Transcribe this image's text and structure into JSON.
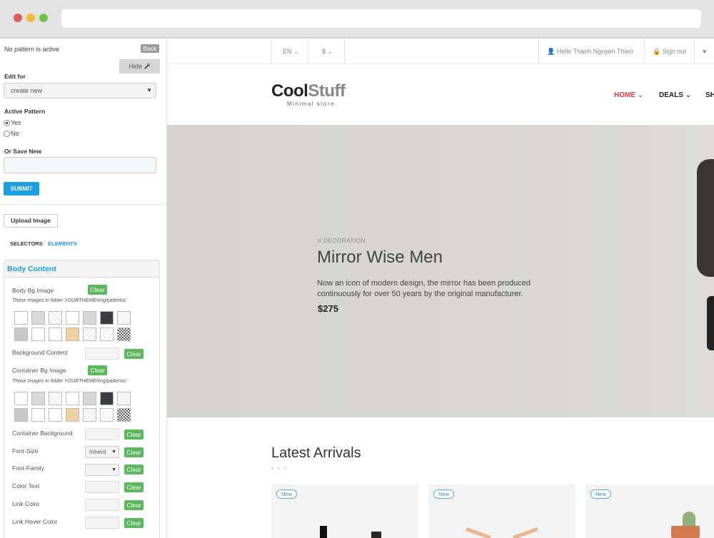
{
  "panel": {
    "status": "No pattern is active",
    "back": "Back",
    "hide": "Hide",
    "edit_for_label": "Edit for",
    "edit_for_value": "create new",
    "active_pattern_label": "Active Pattern",
    "yes": "Yes",
    "no": "No",
    "save_new_label": "Or Save New",
    "submit": "SUBMIT",
    "upload": "Upload Image",
    "tab_selectors": "SELECTORS",
    "tab_elements": "ELEMENTS"
  },
  "body_content": {
    "title": "Body Content",
    "clear": "Clear",
    "body_bg_image": "Body Bg Image",
    "folder_note": "Those Images in folder YOURTHEME/img/patterns/",
    "background_content": "Background Content",
    "container_bg_image": "Container Bg Image",
    "container_background": "Container Background",
    "font_size": "Font-Size",
    "font_size_value": "Inherit",
    "font_family": "Font-Family",
    "color_text": "Color Text",
    "link_color": "Link Color",
    "link_hover_color": "Link Hover Color"
  },
  "topbar": {
    "lang": "EN",
    "currency": "$",
    "greeting": "Hello Thanh Nguyen Thien",
    "signout": "Sign out"
  },
  "logo": {
    "part1": "Cool",
    "part2": "Stuff",
    "tagline": "Minimal store"
  },
  "nav": {
    "home": "HOME",
    "deals": "DEALS",
    "partial": "SH"
  },
  "hero": {
    "category": "// DECORATION",
    "title": "Mirror Wise Men",
    "description": "Now an icon of modern design, the mirror has been produced continuously for over 50 years by the original manufacturer.",
    "price": "$275"
  },
  "latest": {
    "title": "Latest Arrivals",
    "dots": "• • •",
    "badge": "New"
  },
  "colors": {
    "accent": "#1a9fe0",
    "clear_green": "#5cb85c",
    "nav_active": "#e03a3a"
  }
}
